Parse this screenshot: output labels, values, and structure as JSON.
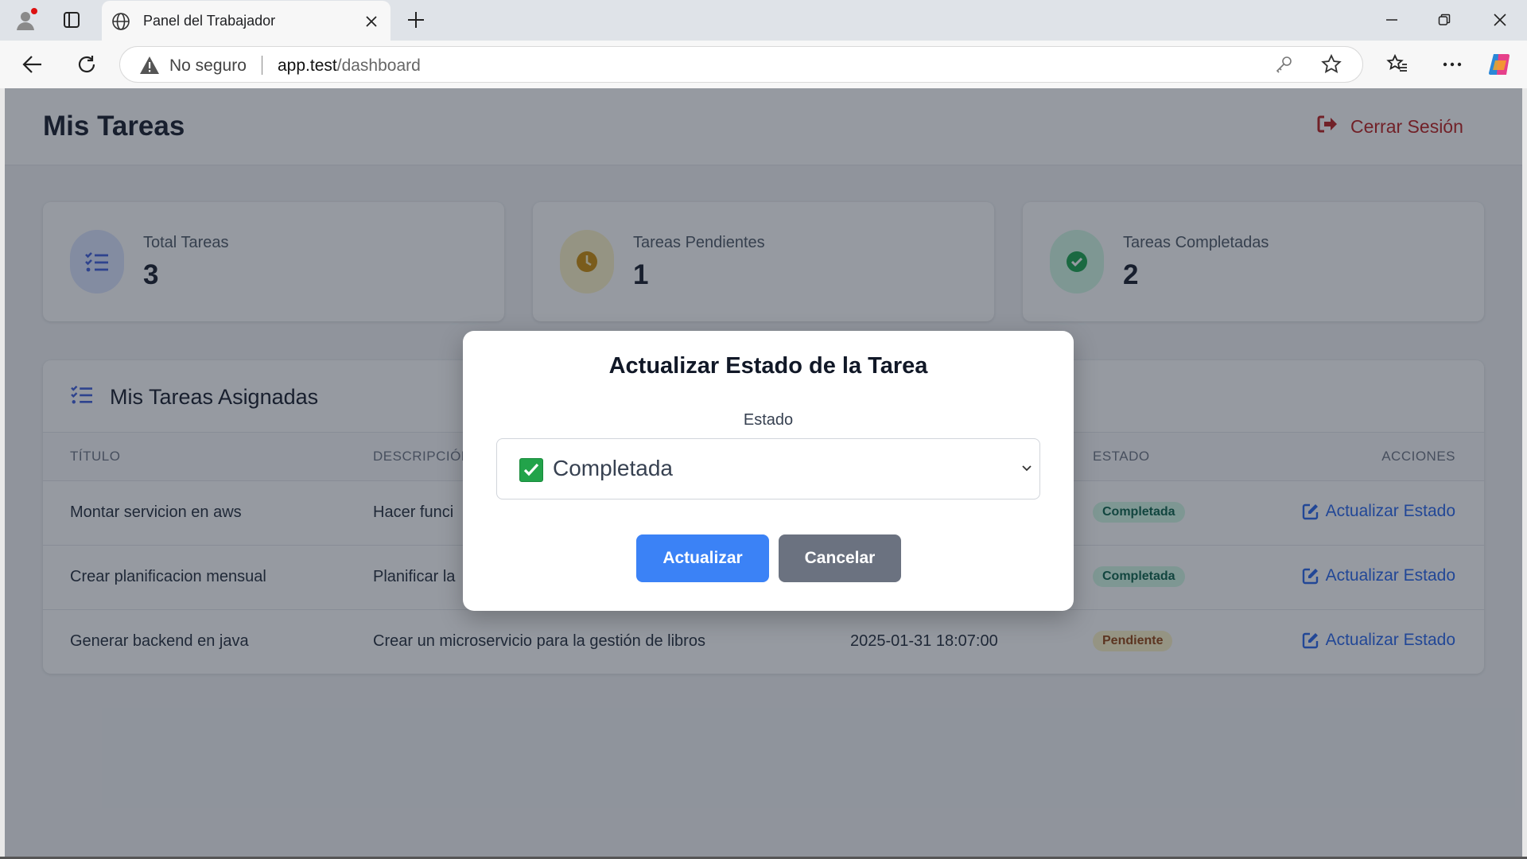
{
  "browser": {
    "tab_title": "Panel del Trabajador",
    "security_text": "No seguro",
    "url_host": "app.test",
    "url_path": "/dashboard"
  },
  "header": {
    "title": "Mis Tareas",
    "logout_label": "Cerrar Sesión"
  },
  "stats": [
    {
      "label": "Total Tareas",
      "value": "3",
      "icon": "list-check-icon",
      "color": "#3b5bdb"
    },
    {
      "label": "Tareas Pendientes",
      "value": "1",
      "icon": "clock-icon",
      "color": "#ca8a04"
    },
    {
      "label": "Tareas Completadas",
      "value": "2",
      "icon": "check-circle-icon",
      "color": "#16a34a"
    }
  ],
  "tasks": {
    "title": "Mis Tareas Asignadas",
    "columns": [
      "TÍTULO",
      "DESCRIPCIÓN",
      "ESTADO",
      "ACCIONES"
    ],
    "rows": [
      {
        "title": "Montar servicion en aws",
        "description": "Hacer funci",
        "date": "",
        "status": "Completada",
        "action": "Actualizar Estado"
      },
      {
        "title": "Crear planificacion mensual",
        "description": "Planificar la",
        "date": "",
        "status": "Completada",
        "action": "Actualizar Estado"
      },
      {
        "title": "Generar backend en java",
        "description": "Crear un microservicio para la gestión de libros",
        "date": "2025-01-31 18:07:00",
        "status": "Pendiente",
        "action": "Actualizar Estado"
      }
    ]
  },
  "modal": {
    "title": "Actualizar Estado de la Tarea",
    "field_label": "Estado",
    "selected_value": "Completada",
    "submit_label": "Actualizar",
    "cancel_label": "Cancelar"
  }
}
